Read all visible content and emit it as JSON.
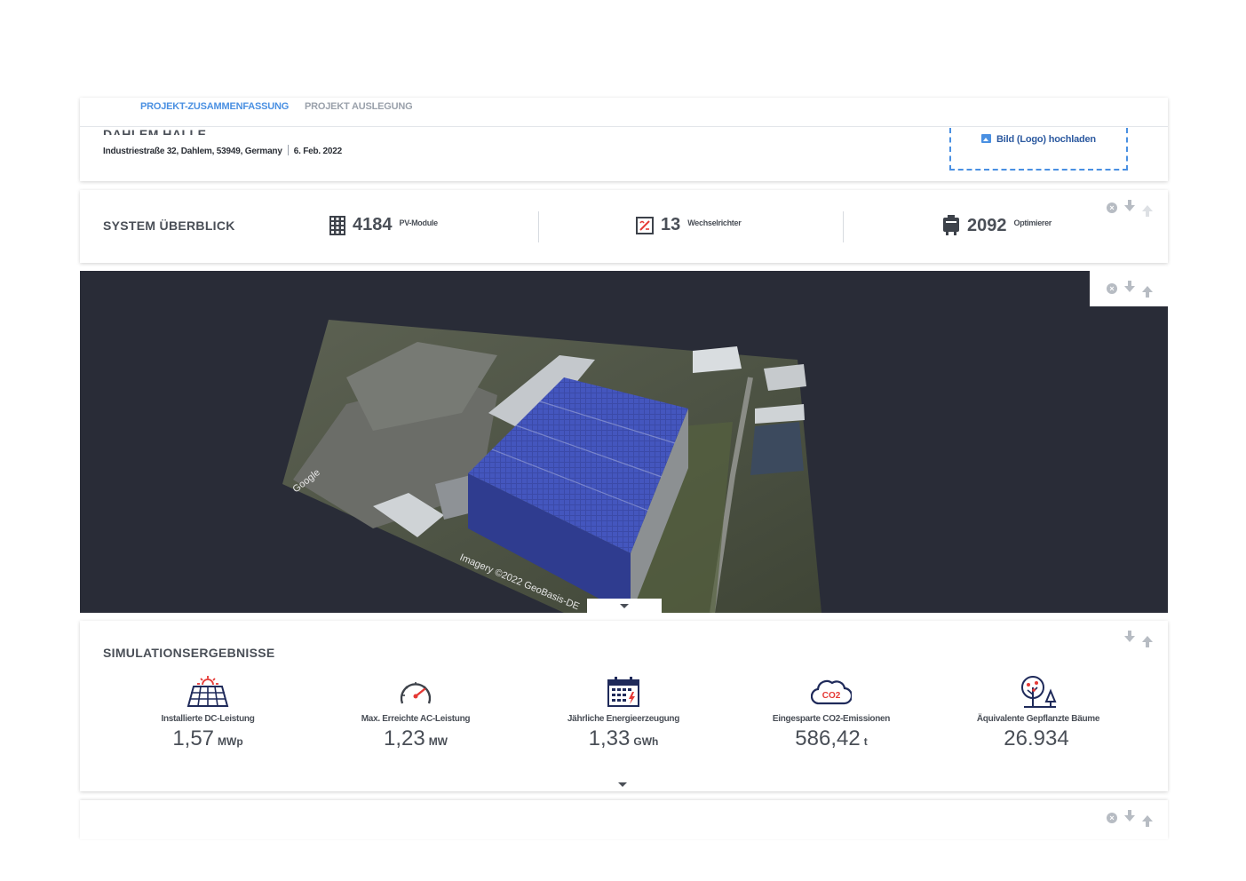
{
  "tabs": [
    {
      "label": "PROJEKT-ZUSAMMENFASSUNG",
      "active": true
    },
    {
      "label": "PROJEKT AUSLEGUNG",
      "active": false
    }
  ],
  "project": {
    "name": "DAHLEM HALLE",
    "address": "Industriestraße 32, Dahlem, 53949, Germany",
    "date": "6. Feb. 2022"
  },
  "upload": {
    "label": "Bild (Logo) hochladen"
  },
  "overview": {
    "title": "SYSTEM ÜBERBLICK",
    "stats": [
      {
        "icon": "solar-module-icon",
        "value": "4184",
        "unit": "PV-Module"
      },
      {
        "icon": "inverter-icon",
        "value": "13",
        "unit": "Wechselrichter"
      },
      {
        "icon": "optimizer-icon",
        "value": "2092",
        "unit": "Optimierer"
      }
    ]
  },
  "map": {
    "attribution_left": "Google",
    "attribution_bottom": "Imagery ©2022 GeoBasis-DE"
  },
  "simulation": {
    "title": "SIMULATIONSERGEBNISSE",
    "metrics": [
      {
        "icon": "solar-panel-sun-icon",
        "label": "Installierte DC-Leistung",
        "value": "1,57",
        "unit": "MWp"
      },
      {
        "icon": "gauge-icon",
        "label": "Max. Erreichte AC-Leistung",
        "value": "1,23",
        "unit": "MW"
      },
      {
        "icon": "calendar-energy-icon",
        "label": "Jährliche Energieerzeugung",
        "value": "1,33",
        "unit": "GWh"
      },
      {
        "icon": "co2-cloud-icon",
        "label": "Eingesparte CO2-Emissionen",
        "value": "586,42",
        "unit": "t"
      },
      {
        "icon": "trees-icon",
        "label": "Äquivalente Gepflanzte Bäume",
        "value": "26.934",
        "unit": ""
      }
    ],
    "co2_badge": "CO2"
  },
  "colors": {
    "accent": "#4a90e2",
    "text": "#4a4f57",
    "map_bg": "#292c37",
    "icon_red": "#e53935",
    "icon_navy": "#1f2a5a"
  }
}
